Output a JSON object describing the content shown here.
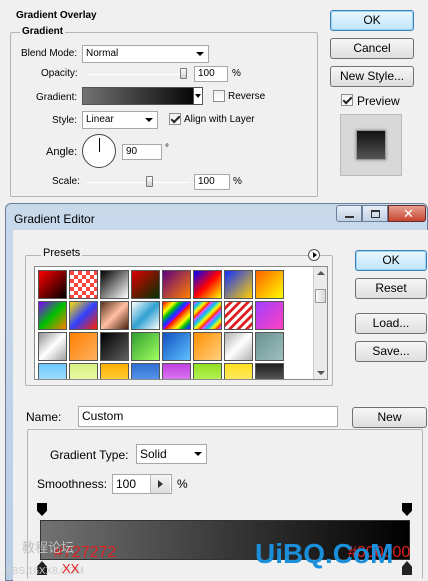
{
  "gradient_overlay": {
    "section_title": "Gradient Overlay",
    "group_title": "Gradient",
    "blend_mode_label": "Blend Mode:",
    "blend_mode_value": "Normal",
    "opacity_label": "Opacity:",
    "opacity_value": "100",
    "opacity_unit": "%",
    "opacity_level_pct": 100,
    "gradient_label": "Gradient:",
    "reverse_label": "Reverse",
    "reverse_checked": false,
    "style_label": "Style:",
    "style_value": "Linear",
    "align_label": "Align with Layer",
    "align_checked": true,
    "angle_label": "Angle:",
    "angle_value": "90",
    "angle_unit": "°",
    "scale_label": "Scale:",
    "scale_value": "100",
    "scale_unit": "%",
    "scale_level_pct": 100
  },
  "dialog_buttons": {
    "ok": "OK",
    "cancel": "Cancel",
    "new_style": "New Style...",
    "preview": "Preview",
    "preview_checked": true
  },
  "gradient_editor": {
    "title": "Gradient Editor",
    "presets_label": "Presets",
    "ok": "OK",
    "reset": "Reset",
    "load": "Load...",
    "save": "Save...",
    "name_label": "Name:",
    "name_value": "Custom",
    "new_button": "New",
    "gradient_type_label": "Gradient Type:",
    "gradient_type_value": "Solid",
    "smoothness_label": "Smoothness:",
    "smoothness_value": "100",
    "smoothness_unit": "%",
    "start_color": "#727272",
    "end_color": "#000000",
    "preset_swatches": [
      "linear-gradient(135deg,#ff0000,#000)",
      "repeating-conic-gradient(#fff 0 25%,#f44 0 50%) 0 0/8px 8px",
      "linear-gradient(135deg,#000,#fff)",
      "linear-gradient(135deg,#d00,#030)",
      "linear-gradient(135deg,#600080,#ff8000)",
      "linear-gradient(135deg,#0000ff,#ff0000,#ffff00)",
      "linear-gradient(135deg,#1030ff,#ffd000)",
      "linear-gradient(135deg,#ff6000,#ffff00)",
      "linear-gradient(135deg,#8000ff,#00c000,#ff8000)",
      "linear-gradient(135deg,#ffe000,#3040ff,#ff2000)",
      "linear-gradient(135deg,#5a3320,#ffc0a0,#4a2010)",
      "linear-gradient(135deg,#ffffff,#30a0d0,#ffffff)",
      "repeating-linear-gradient(135deg,#ff0000,#ff8000 4px,#ffff00 8px,#00c000 12px,#0040ff 16px,#a000ff 20px)",
      "repeating-linear-gradient(135deg,#ff40ff,#00c0ff 4px,#ffff00 8px,#ff0000 12px)",
      "repeating-linear-gradient(135deg,#fff 0 3px,#e02020 3px 6px)",
      "linear-gradient(135deg,#a040ff,#ff40c0)",
      "linear-gradient(135deg,#909090,#ffffff,#a0a0a0)",
      "linear-gradient(135deg,#ff8000,#ffb060)",
      "linear-gradient(135deg,#000,#606060)",
      "linear-gradient(135deg,#30a030,#a0ff60)",
      "linear-gradient(135deg,#1050c0,#60c0ff)",
      "linear-gradient(135deg,#ff9000,#ffd080)",
      "linear-gradient(135deg,#b0b0b0,#ffffff,#b0b0b0)",
      "linear-gradient(135deg,#6a9090,#a0c0c0)",
      "linear-gradient(#70c8ff,#c0ecff)",
      "linear-gradient(#d8f080,#f8ffc0)",
      "linear-gradient(#ffb000,#ffe060)",
      "linear-gradient(#3070d0,#70b0ff)",
      "linear-gradient(#c040e0,#f0a0ff)",
      "linear-gradient(#90e020,#d0ff80)",
      "linear-gradient(#ffe020,#fff090)",
      "linear-gradient(#202020,#808080)"
    ]
  },
  "watermark": {
    "site_text": "UiBQ.CoM",
    "forum_text": "教程论坛",
    "small_text": "BBS.16XX8.COM",
    "xx": "XX"
  }
}
